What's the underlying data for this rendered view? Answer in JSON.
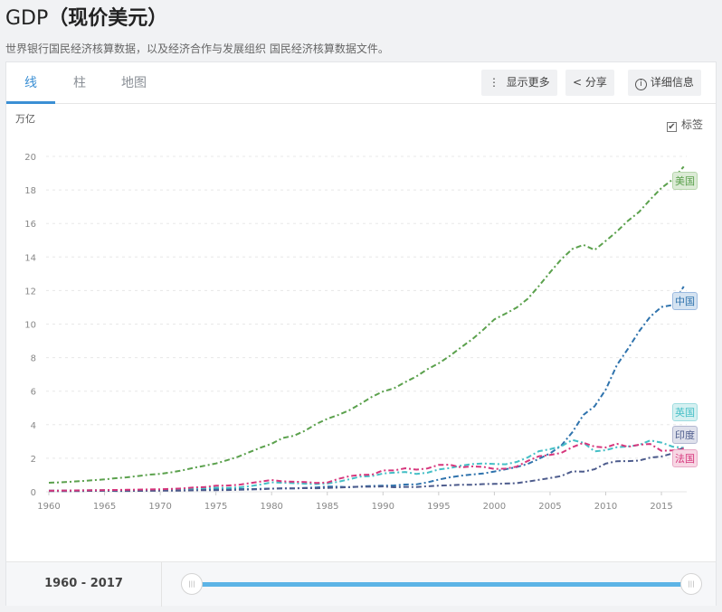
{
  "header": {
    "title_prefix": "GDP",
    "title_main": "（现价美元）",
    "subtitle": "世界银行国民经济核算数据，以及经济合作与发展组织 国民经济核算数据文件。"
  },
  "tabs": [
    {
      "label": "线",
      "active": true
    },
    {
      "label": "柱"
    },
    {
      "label": "地图"
    }
  ],
  "toolbar": {
    "more": "显示更多",
    "share": "分享",
    "details": "详细信息",
    "more_icon": "vertical-dots-icon",
    "share_icon": "share-icon",
    "details_icon": "info-icon"
  },
  "labels_toggle": {
    "label": "标签",
    "checked": true
  },
  "range": {
    "text": "1960 - 2017",
    "start": 1960,
    "end": 2017
  },
  "chart_data": {
    "type": "line",
    "title": "GDP（现价美元）",
    "ylabel": "万亿",
    "xlabel": "",
    "ylim": [
      0,
      20
    ],
    "xlim": [
      1960,
      2017
    ],
    "yticks": [
      "0",
      "2",
      "4",
      "6",
      "8",
      "10",
      "12",
      "14",
      "16",
      "18",
      "20"
    ],
    "xticks": [
      "1960",
      "1965",
      "1970",
      "1975",
      "1980",
      "1985",
      "1990",
      "1995",
      "2000",
      "2005",
      "2010",
      "2015"
    ],
    "grid": true,
    "x_start": 1960,
    "series": [
      {
        "name": "美国",
        "color": "#5ba14d",
        "values": [
          0.54,
          0.56,
          0.6,
          0.64,
          0.69,
          0.74,
          0.81,
          0.86,
          0.94,
          1.02,
          1.07,
          1.16,
          1.28,
          1.43,
          1.55,
          1.69,
          1.88,
          2.09,
          2.36,
          2.63,
          2.86,
          3.21,
          3.34,
          3.64,
          4.04,
          4.35,
          4.59,
          4.87,
          5.25,
          5.66,
          5.98,
          6.17,
          6.54,
          6.88,
          7.31,
          7.66,
          8.1,
          8.61,
          9.09,
          9.66,
          10.28,
          10.62,
          10.98,
          11.51,
          12.27,
          13.09,
          13.86,
          14.48,
          14.72,
          14.42,
          14.96,
          15.52,
          16.16,
          16.69,
          17.43,
          18.12,
          18.62,
          19.39
        ]
      },
      {
        "name": "中国",
        "color": "#2f73ad",
        "values": [
          0.06,
          0.05,
          0.047,
          0.05,
          0.06,
          0.07,
          0.076,
          0.072,
          0.07,
          0.079,
          0.093,
          0.1,
          0.11,
          0.14,
          0.14,
          0.16,
          0.15,
          0.17,
          0.15,
          0.18,
          0.19,
          0.2,
          0.2,
          0.23,
          0.26,
          0.31,
          0.3,
          0.27,
          0.31,
          0.35,
          0.36,
          0.38,
          0.43,
          0.44,
          0.56,
          0.73,
          0.86,
          0.96,
          1.03,
          1.09,
          1.21,
          1.34,
          1.47,
          1.66,
          1.96,
          2.29,
          2.75,
          3.55,
          4.59,
          5.1,
          6.09,
          7.55,
          8.53,
          9.57,
          10.44,
          11.02,
          11.14,
          12.24
        ]
      },
      {
        "name": "英国",
        "color": "#45bfc6",
        "values": [
          0.072,
          0.077,
          0.081,
          0.086,
          0.094,
          0.1,
          0.11,
          0.11,
          0.1,
          0.11,
          0.13,
          0.15,
          0.17,
          0.19,
          0.21,
          0.24,
          0.23,
          0.26,
          0.33,
          0.43,
          0.56,
          0.54,
          0.51,
          0.48,
          0.46,
          0.49,
          0.6,
          0.75,
          0.91,
          0.93,
          1.09,
          1.14,
          1.18,
          1.06,
          1.14,
          1.33,
          1.41,
          1.56,
          1.65,
          1.69,
          1.66,
          1.64,
          1.78,
          2.05,
          2.42,
          2.54,
          2.71,
          3.09,
          2.92,
          2.41,
          2.48,
          2.66,
          2.7,
          2.79,
          3.06,
          2.93,
          2.69,
          2.62
        ]
      },
      {
        "name": "印度",
        "color": "#4c5b8c",
        "values": [
          0.037,
          0.039,
          0.042,
          0.049,
          0.056,
          0.059,
          0.046,
          0.05,
          0.053,
          0.058,
          0.062,
          0.067,
          0.071,
          0.085,
          0.099,
          0.098,
          0.1,
          0.12,
          0.14,
          0.15,
          0.19,
          0.2,
          0.2,
          0.22,
          0.21,
          0.23,
          0.25,
          0.28,
          0.3,
          0.3,
          0.32,
          0.27,
          0.29,
          0.28,
          0.33,
          0.36,
          0.39,
          0.42,
          0.42,
          0.46,
          0.47,
          0.49,
          0.51,
          0.61,
          0.71,
          0.82,
          0.94,
          1.22,
          1.2,
          1.34,
          1.68,
          1.82,
          1.83,
          1.86,
          2.04,
          2.1,
          2.29,
          2.65
        ]
      },
      {
        "name": "法国",
        "color": "#d6367c",
        "values": [
          0.062,
          0.068,
          0.076,
          0.085,
          0.094,
          0.1,
          0.11,
          0.12,
          0.13,
          0.14,
          0.15,
          0.17,
          0.2,
          0.26,
          0.28,
          0.36,
          0.37,
          0.41,
          0.51,
          0.61,
          0.7,
          0.62,
          0.6,
          0.58,
          0.53,
          0.55,
          0.77,
          0.93,
          1.01,
          1.02,
          1.27,
          1.27,
          1.4,
          1.32,
          1.39,
          1.6,
          1.61,
          1.46,
          1.51,
          1.49,
          1.36,
          1.38,
          1.5,
          1.84,
          2.12,
          2.2,
          2.32,
          2.66,
          2.92,
          2.69,
          2.64,
          2.86,
          2.68,
          2.81,
          2.85,
          2.44,
          2.47,
          2.58
        ]
      }
    ]
  }
}
